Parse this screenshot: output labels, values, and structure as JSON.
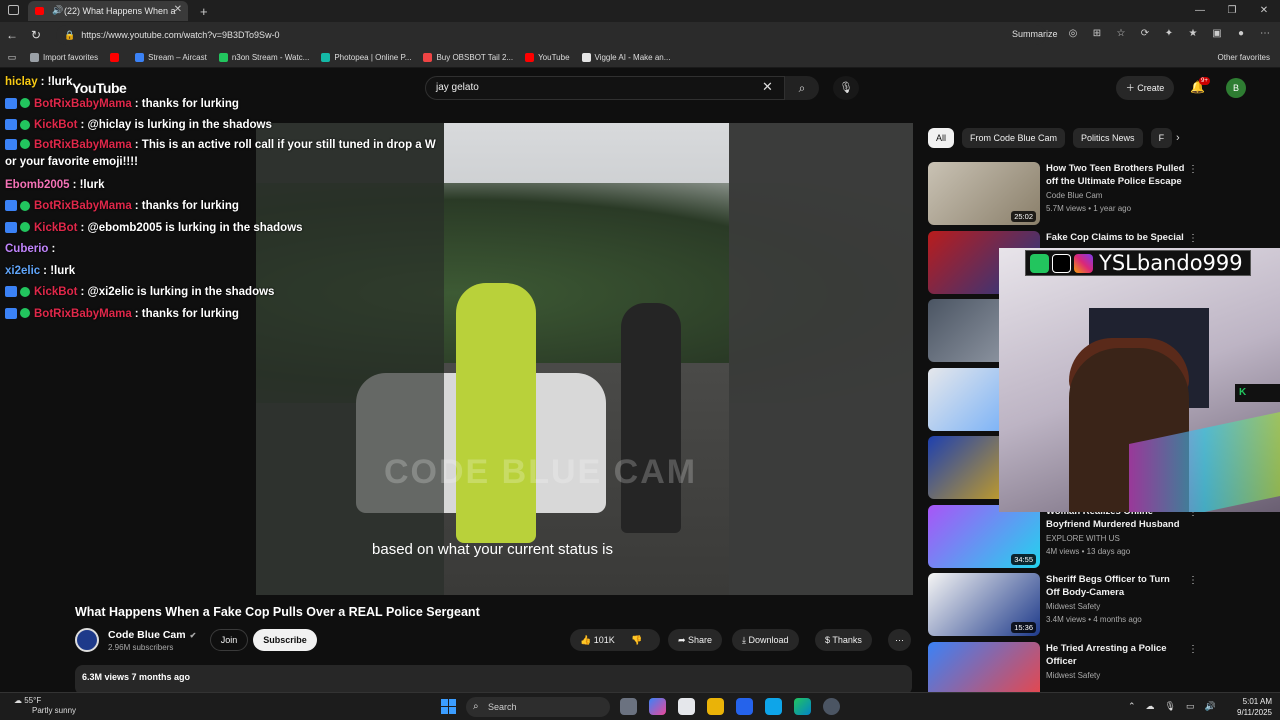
{
  "browser": {
    "tab_title": "(22) What Happens When a",
    "url": "https://www.youtube.com/watch?v=9B3DTo9Sw-0",
    "summarize_label": "Summarize",
    "bookmarks": [
      {
        "label": "Import favorites",
        "color": "#9aa0a6"
      },
      {
        "label": "",
        "color": "#ff0000"
      },
      {
        "label": "Stream – Aircast",
        "color": "#3b82f6"
      },
      {
        "label": "n3on Stream - Watc...",
        "color": "#22c55e"
      },
      {
        "label": "Photopea | Online P...",
        "color": "#14b8a6"
      },
      {
        "label": "Buy OBSBOT Tail 2...",
        "color": "#ef4444"
      },
      {
        "label": "YouTube",
        "color": "#ff0000"
      },
      {
        "label": "Viggle AI - Make an...",
        "color": "#e5e5e5"
      }
    ],
    "other_favorites": "Other favorites"
  },
  "youtube": {
    "logo_text": "YouTube",
    "search_value": "jay gelato",
    "create_label": "Create",
    "notif_badge": "9+",
    "avatar_letter": "B"
  },
  "chat": [
    {
      "user": "hiclay",
      "user_class": "u-hiclay",
      "badges": false,
      "text": ": !lurk"
    },
    {
      "user": "BotRixBabyMama",
      "user_class": "u-bot",
      "badges": true,
      "text": ": thanks for lurking"
    },
    {
      "user": "KickBot",
      "user_class": "u-kick",
      "badges": true,
      "text": ": @hiclay is lurking in the shadows"
    },
    {
      "user": "BotRixBabyMama",
      "user_class": "u-bot",
      "badges": true,
      "text": ": This is an active roll call if your still tuned in drop a W or your favorite emoji!!!!"
    },
    {
      "user": "Ebomb2005",
      "user_class": "u-ebomb",
      "badges": false,
      "text": ": !lurk"
    },
    {
      "user": "BotRixBabyMama",
      "user_class": "u-bot",
      "badges": true,
      "text": ": thanks for lurking"
    },
    {
      "user": "KickBot",
      "user_class": "u-kick",
      "badges": true,
      "text": ": @ebomb2005 is lurking in the shadows"
    },
    {
      "user": "Cuberio",
      "user_class": "u-cuberio",
      "badges": false,
      "text": ":"
    },
    {
      "user": "xi2elic",
      "user_class": "u-xi2",
      "badges": false,
      "text": ": !lurk"
    },
    {
      "user": "KickBot",
      "user_class": "u-kick",
      "badges": true,
      "text": ": @xi2elic is lurking in the shadows"
    },
    {
      "user": "BotRixBabyMama",
      "user_class": "u-bot",
      "badges": true,
      "text": ": thanks for lurking"
    }
  ],
  "video": {
    "watermark": "CODE BLUE CAM",
    "caption": "based on what your current status is",
    "title": "What Happens When a Fake Cop Pulls Over a REAL Police Sergeant",
    "channel": "Code Blue Cam",
    "subscribers": "2.96M subscribers",
    "join_label": "Join",
    "subscribe_label": "Subscribe",
    "likes": "101K",
    "share_label": "Share",
    "download_label": "Download",
    "thanks_label": "Thanks",
    "meta": "6.3M views  7 months ago"
  },
  "chips": [
    {
      "label": "All",
      "active": true
    },
    {
      "label": "From Code Blue Cam",
      "active": false
    },
    {
      "label": "Politics News",
      "active": false
    },
    {
      "label": "F",
      "active": false
    }
  ],
  "recommendations": [
    {
      "title": "How Two Teen Brothers Pulled off the Ultimate Police Escape",
      "channel": "Code Blue Cam",
      "meta": "5.7M views • 1 year ago",
      "duration": "25:02",
      "thumb": "linear-gradient(135deg,#c9c2b4,#8a7f6a)"
    },
    {
      "title": "Fake Cop Claims to be Special",
      "channel": "",
      "meta": "",
      "duration": "",
      "thumb": "linear-gradient(135deg,#b91c1c,#1e3a8a)"
    },
    {
      "title": "",
      "channel": "",
      "meta": "",
      "duration": "",
      "thumb": "linear-gradient(135deg,#4b5563,#9ca3af)"
    },
    {
      "title": "",
      "channel": "",
      "meta": "",
      "duration": "",
      "thumb": "linear-gradient(135deg,#e5e7eb,#60a5fa)"
    },
    {
      "title": "",
      "channel": "",
      "meta": "",
      "duration": "",
      "thumb": "linear-gradient(135deg,#1e40af,#eab308)"
    },
    {
      "title": "Woman Realizes Online Boyfriend Murdered Husband",
      "channel": "EXPLORE WITH US",
      "meta": "4M views • 13 days ago",
      "duration": "34:55",
      "thumb": "linear-gradient(135deg,#a855f7,#22d3ee)"
    },
    {
      "title": "Sheriff Begs Officer to Turn Off Body-Camera",
      "channel": "Midwest Safety",
      "meta": "3.4M views • 4 months ago",
      "duration": "15:36",
      "thumb": "linear-gradient(135deg,#f5f5f4,#1e3a8a)"
    },
    {
      "title": "He Tried Arresting a Police Officer",
      "channel": "Midwest Safety",
      "meta": "",
      "duration": "",
      "thumb": "linear-gradient(135deg,#3b82f6,#ef4444)"
    }
  ],
  "webcam": {
    "handle": "YSLbando999",
    "kick_label": "K"
  },
  "taskbar": {
    "weather_temp": "55°F",
    "weather_desc": "Partly sunny",
    "search_label": "Search",
    "time": "5:01 AM",
    "date": "9/11/2025"
  }
}
